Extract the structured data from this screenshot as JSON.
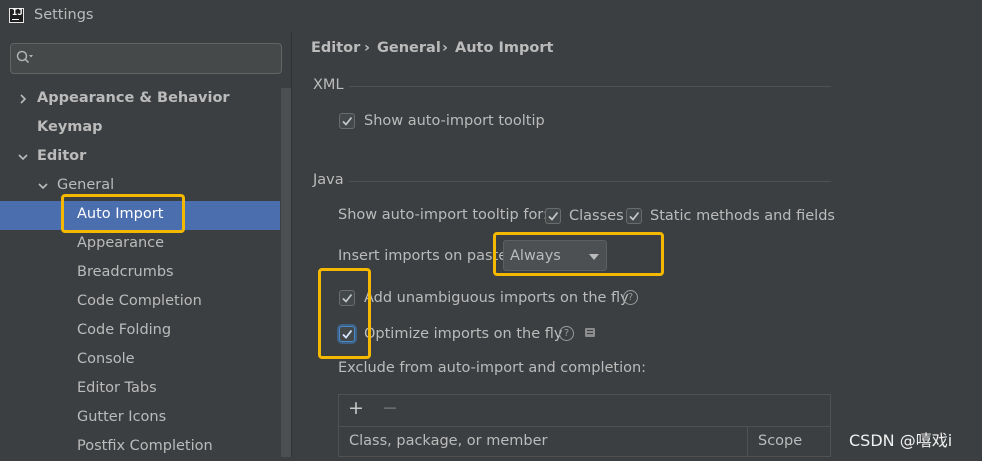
{
  "window": {
    "title": "Settings",
    "app_icon_text": "IJ"
  },
  "search": {
    "placeholder": "",
    "value": ""
  },
  "sidebar": {
    "items": [
      {
        "label": "Appearance & Behavior",
        "chevron": "right"
      },
      {
        "label": "Keymap"
      },
      {
        "label": "Editor",
        "chevron": "down"
      },
      {
        "label": "General",
        "chevron": "down"
      },
      {
        "label": "Auto Import",
        "selected": true
      },
      {
        "label": "Appearance"
      },
      {
        "label": "Breadcrumbs"
      },
      {
        "label": "Code Completion"
      },
      {
        "label": "Code Folding"
      },
      {
        "label": "Console"
      },
      {
        "label": "Editor Tabs"
      },
      {
        "label": "Gutter Icons"
      },
      {
        "label": "Postfix Completion"
      }
    ]
  },
  "breadcrumb": {
    "items": [
      "Editor",
      "General",
      "Auto Import"
    ],
    "separator": "›"
  },
  "xml": {
    "title": "XML",
    "show_tooltip": {
      "label": "Show auto-import tooltip",
      "checked": true
    }
  },
  "java": {
    "title": "Java",
    "tooltip_for_label": "Show auto-import tooltip for:",
    "classes": {
      "label": "Classes",
      "checked": true
    },
    "static_methods": {
      "label": "Static methods and fields",
      "checked": true
    },
    "insert_on_paste_label": "Insert imports on paste:",
    "insert_on_paste_value": "Always",
    "add_unambiguous": {
      "label": "Add unambiguous imports on the fly",
      "checked": true
    },
    "optimize": {
      "label": "Optimize imports on the fly",
      "checked": true
    },
    "exclude_label": "Exclude from auto-import and completion:",
    "toolbar": {
      "add": "+",
      "remove": "−"
    },
    "table_columns": [
      "Class, package, or member",
      "Scope"
    ]
  },
  "colors": {
    "background": "#3c3f41",
    "selection": "#4b6eaf",
    "highlight_box": "#f5b800",
    "text": "#bbbbbb"
  },
  "watermark": "CSDN @嘻戏i"
}
